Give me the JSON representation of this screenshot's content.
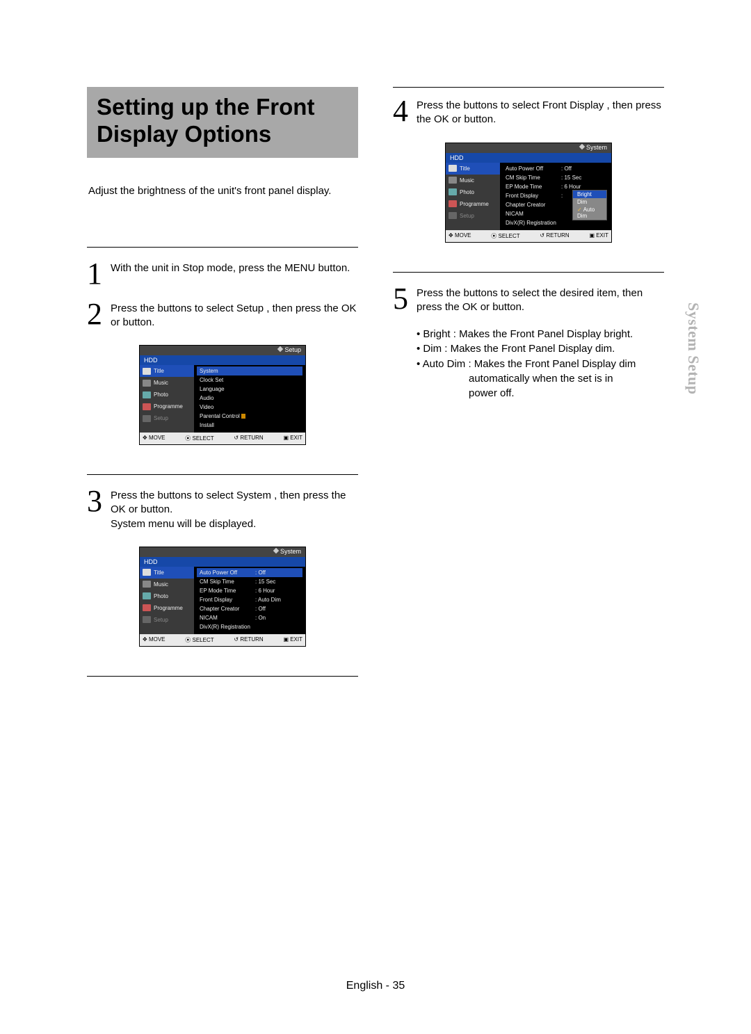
{
  "title": "Setting up the Front Display Options",
  "intro": "Adjust the brightness of the unit's front panel display.",
  "side_label": "System Setup",
  "footer": "English - 35",
  "steps": {
    "s1": {
      "num": "1",
      "text": "With the unit in Stop mode, press the MENU button."
    },
    "s2": {
      "num": "2",
      "text_a": "Press the ",
      "text_b": " buttons to select Setup , then press the OK or ",
      "text_c": " button."
    },
    "s3": {
      "num": "3",
      "text_a": "Press the ",
      "text_b": " buttons to select System , then press the OK or ",
      "text_c": " button.",
      "text_d": "System menu will be displayed."
    },
    "s4": {
      "num": "4",
      "text_a": "Press the ",
      "text_b": " buttons to select Front Display , then press the OK or ",
      "text_c": " button."
    },
    "s5": {
      "num": "5",
      "text_a": "Press the ",
      "text_b": " buttons to select the desired item, then press the OK or ",
      "text_c": " button.",
      "bullets": [
        "• Bright  : Makes the Front Panel Display bright.",
        "• Dim  : Makes the Front Panel Display dim.",
        "• Auto Dim  : Makes the Front Panel Display dim"
      ],
      "sub1": "automatically when the set is in",
      "sub2": "power off."
    }
  },
  "osd": {
    "sidebar": {
      "hdd": "HDD",
      "title": "Title",
      "music": "Music",
      "photo": "Photo",
      "programme": "Programme",
      "setup": "Setup"
    },
    "footer": {
      "move": "MOVE",
      "select": "SELECT",
      "return": "RETURN",
      "exit": "EXIT"
    },
    "setup_crumb": "Setup",
    "system_crumb": "System",
    "setup_menu": {
      "items": [
        "System",
        "Clock Set",
        "Language",
        "Audio",
        "Video",
        "Parental Control",
        "Install"
      ]
    },
    "system_menu": {
      "rows": [
        {
          "label": "Auto Power Off",
          "value": ": Off"
        },
        {
          "label": "CM Skip Time",
          "value": ": 15 Sec"
        },
        {
          "label": "EP Mode Time",
          "value": ": 6 Hour"
        },
        {
          "label": "Front Display",
          "value": ": Auto Dim"
        },
        {
          "label": "Chapter Creator",
          "value": ": Off"
        },
        {
          "label": "NICAM",
          "value": ": On"
        },
        {
          "label": "DivX(R) Registration",
          "value": ""
        }
      ]
    },
    "system_menu_fd": {
      "rows": [
        {
          "label": "Auto Power Off",
          "value": ": Off"
        },
        {
          "label": "CM Skip Time",
          "value": ": 15 Sec"
        },
        {
          "label": "EP Mode Time",
          "value": ": 6 Hour"
        },
        {
          "label": "Front Display",
          "value": ":"
        },
        {
          "label": "Chapter Creator",
          "value": ""
        },
        {
          "label": "NICAM",
          "value": ""
        },
        {
          "label": "DivX(R) Registration",
          "value": ""
        }
      ],
      "dropdown": [
        "Bright",
        "Dim",
        "Auto Dim"
      ]
    }
  }
}
